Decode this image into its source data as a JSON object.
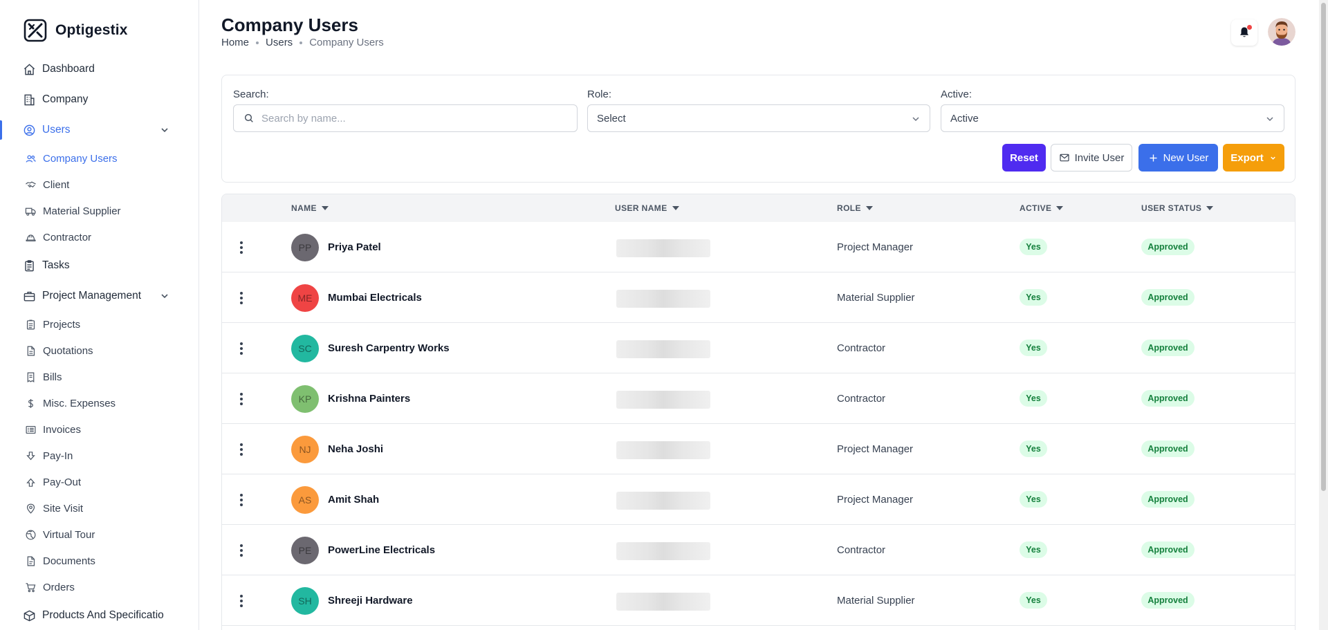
{
  "app": {
    "name": "Optigestix"
  },
  "sidebar": {
    "items": [
      {
        "label": "Dashboard",
        "icon": "home-icon"
      },
      {
        "label": "Company",
        "icon": "building-icon"
      },
      {
        "label": "Users",
        "icon": "user-circle-icon",
        "expanded": true,
        "children": [
          {
            "label": "Company Users",
            "icon": "users-icon",
            "active": true
          },
          {
            "label": "Client",
            "icon": "handshake-icon"
          },
          {
            "label": "Material Supplier",
            "icon": "truck-icon"
          },
          {
            "label": "Contractor",
            "icon": "hard-hat-icon"
          }
        ]
      },
      {
        "label": "Tasks",
        "icon": "clipboard-icon"
      },
      {
        "label": "Project Management",
        "icon": "briefcase-icon",
        "expanded": true,
        "children": [
          {
            "label": "Projects",
            "icon": "clipboard-list-icon"
          },
          {
            "label": "Quotations",
            "icon": "document-icon"
          },
          {
            "label": "Bills",
            "icon": "bill-icon"
          },
          {
            "label": "Misc. Expenses",
            "icon": "dollar-icon"
          },
          {
            "label": "Invoices",
            "icon": "invoice-icon"
          },
          {
            "label": "Pay-In",
            "icon": "arrow-down-icon"
          },
          {
            "label": "Pay-Out",
            "icon": "arrow-up-icon"
          },
          {
            "label": "Site Visit",
            "icon": "map-pin-icon"
          },
          {
            "label": "Virtual Tour",
            "icon": "globe-icon"
          },
          {
            "label": "Documents",
            "icon": "file-icon"
          },
          {
            "label": "Orders",
            "icon": "cart-icon"
          }
        ]
      },
      {
        "label": "Products And Specificatio",
        "icon": "box-icon"
      }
    ]
  },
  "header": {
    "title": "Company Users",
    "breadcrumb": [
      "Home",
      "Users",
      "Company Users"
    ]
  },
  "filters": {
    "search": {
      "label": "Search:",
      "placeholder": "Search by name..."
    },
    "role": {
      "label": "Role:",
      "value": "Select"
    },
    "active": {
      "label": "Active:",
      "value": "Active"
    }
  },
  "actions": {
    "reset": "Reset",
    "invite": "Invite User",
    "new_user": "New User",
    "export": "Export"
  },
  "table": {
    "columns": [
      "NAME",
      "USER NAME",
      "ROLE",
      "ACTIVE",
      "USER STATUS"
    ],
    "rows": [
      {
        "initials": "PP",
        "name": "Priya Patel",
        "role": "Project Manager",
        "active": "Yes",
        "status": "Approved",
        "color": "#6b6870"
      },
      {
        "initials": "ME",
        "name": "Mumbai Electricals",
        "role": "Material Supplier",
        "active": "Yes",
        "status": "Approved",
        "color": "#ef4444"
      },
      {
        "initials": "SC",
        "name": "Suresh Carpentry Works",
        "role": "Contractor",
        "active": "Yes",
        "status": "Approved",
        "color": "#22b8a0"
      },
      {
        "initials": "KP",
        "name": "Krishna Painters",
        "role": "Contractor",
        "active": "Yes",
        "status": "Approved",
        "color": "#7fbf70"
      },
      {
        "initials": "NJ",
        "name": "Neha Joshi",
        "role": "Project Manager",
        "active": "Yes",
        "status": "Approved",
        "color": "#fb9a3c"
      },
      {
        "initials": "AS",
        "name": "Amit Shah",
        "role": "Project Manager",
        "active": "Yes",
        "status": "Approved",
        "color": "#fb9a3c"
      },
      {
        "initials": "PE",
        "name": "PowerLine Electricals",
        "role": "Contractor",
        "active": "Yes",
        "status": "Approved",
        "color": "#6b6870"
      },
      {
        "initials": "SH",
        "name": "Shreeji Hardware",
        "role": "Material Supplier",
        "active": "Yes",
        "status": "Approved",
        "color": "#22b8a0"
      }
    ]
  },
  "colors": {
    "accent": "#3b6fea",
    "reset": "#4f2bf0",
    "export": "#f59e0b",
    "badge_bg": "#dcfce7",
    "badge_text": "#15803d"
  }
}
